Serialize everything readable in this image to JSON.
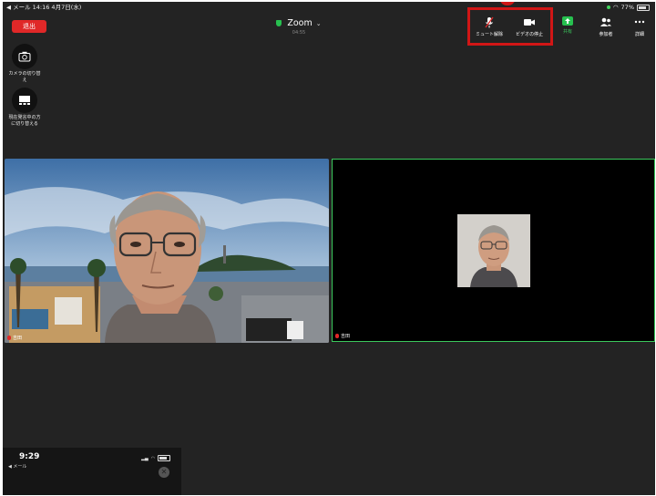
{
  "status_bar": {
    "left": "◀ メール  14:16  4月7日(水)",
    "battery": "77%"
  },
  "header": {
    "leave_label": "退出",
    "title": "Zoom",
    "timer": "04:55"
  },
  "toolbar": {
    "mute_label": "ミュート解除",
    "video_label": "ビデオの停止",
    "share_label": "共有",
    "participants_label": "参加者",
    "more_label": "詳細"
  },
  "side": {
    "camera_switch_label": "カメラの切り替え",
    "speaker_view_label": "現在発言中の方に切り替える"
  },
  "tiles": [
    {
      "name": "吉田"
    },
    {
      "name": "吉田"
    }
  ],
  "phone_overlay": {
    "time": "9:29",
    "back_label": "◀ メール",
    "close_symbol": "✕"
  },
  "colors": {
    "accent_red": "#d11616",
    "active_green": "#3bc75c",
    "leave_red": "#e02828"
  }
}
